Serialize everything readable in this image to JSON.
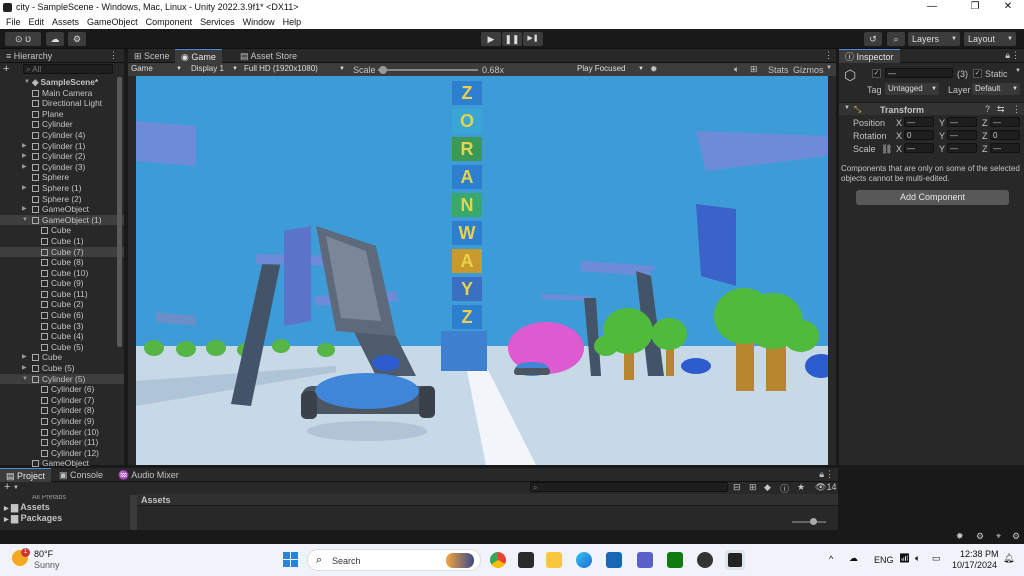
{
  "window": {
    "title": "city - SampleScene - Windows, Mac, Linux - Unity 2022.3.9f1* <DX11>",
    "minimize": "—",
    "maximize": "❐",
    "close": "✕"
  },
  "menu": [
    "File",
    "Edit",
    "Assets",
    "GameObject",
    "Component",
    "Services",
    "Window",
    "Help"
  ],
  "toolbar": {
    "account": "⊙ ט",
    "cloud": "☁",
    "play": "▶",
    "pause": "❚❚",
    "step": "▶❚",
    "layers": "Layers",
    "layout": "Layout",
    "history": "↺",
    "search": "⌕"
  },
  "hierarchy": {
    "tab": "Hierarchy",
    "add": "+",
    "search_placeholder": "All",
    "scene": "SampleScene*",
    "items": [
      {
        "label": "Main Camera",
        "indent": 2,
        "arrow": ""
      },
      {
        "label": "Directional Light",
        "indent": 2,
        "arrow": ""
      },
      {
        "label": "Plane",
        "indent": 2,
        "arrow": ""
      },
      {
        "label": "Cylinder",
        "indent": 2,
        "arrow": ""
      },
      {
        "label": "Cylinder (4)",
        "indent": 2,
        "arrow": ""
      },
      {
        "label": "Cylinder (1)",
        "indent": 2,
        "arrow": "▶"
      },
      {
        "label": "Cylinder (2)",
        "indent": 2,
        "arrow": "▶"
      },
      {
        "label": "Cylinder (3)",
        "indent": 2,
        "arrow": "▶"
      },
      {
        "label": "Sphere",
        "indent": 2,
        "arrow": ""
      },
      {
        "label": "Sphere (1)",
        "indent": 2,
        "arrow": "▶"
      },
      {
        "label": "Sphere (2)",
        "indent": 2,
        "arrow": ""
      },
      {
        "label": "GameObject",
        "indent": 2,
        "arrow": "▶"
      },
      {
        "label": "GameObject (1)",
        "indent": 2,
        "arrow": "▼",
        "sel": true
      },
      {
        "label": "Cube",
        "indent": 3,
        "arrow": ""
      },
      {
        "label": "Cube (1)",
        "indent": 3,
        "arrow": ""
      },
      {
        "label": "Cube (7)",
        "indent": 3,
        "arrow": "",
        "sel": true
      },
      {
        "label": "Cube (8)",
        "indent": 3,
        "arrow": ""
      },
      {
        "label": "Cube (10)",
        "indent": 3,
        "arrow": ""
      },
      {
        "label": "Cube (9)",
        "indent": 3,
        "arrow": ""
      },
      {
        "label": "Cube (11)",
        "indent": 3,
        "arrow": ""
      },
      {
        "label": "Cube (2)",
        "indent": 3,
        "arrow": ""
      },
      {
        "label": "Cube (6)",
        "indent": 3,
        "arrow": ""
      },
      {
        "label": "Cube (3)",
        "indent": 3,
        "arrow": ""
      },
      {
        "label": "Cube (4)",
        "indent": 3,
        "arrow": ""
      },
      {
        "label": "Cube (5)",
        "indent": 3,
        "arrow": ""
      },
      {
        "label": "Cube",
        "indent": 2,
        "arrow": "▶"
      },
      {
        "label": "Cube (5)",
        "indent": 2,
        "arrow": "▶"
      },
      {
        "label": "Cylinder (5)",
        "indent": 2,
        "arrow": "▼",
        "sel": true
      },
      {
        "label": "Cylinder (6)",
        "indent": 3,
        "arrow": ""
      },
      {
        "label": "Cylinder (7)",
        "indent": 3,
        "arrow": ""
      },
      {
        "label": "Cylinder (8)",
        "indent": 3,
        "arrow": ""
      },
      {
        "label": "Cylinder (9)",
        "indent": 3,
        "arrow": ""
      },
      {
        "label": "Cylinder (10)",
        "indent": 3,
        "arrow": ""
      },
      {
        "label": "Cylinder (11)",
        "indent": 3,
        "arrow": ""
      },
      {
        "label": "Cylinder (12)",
        "indent": 3,
        "arrow": ""
      },
      {
        "label": "GameObject",
        "indent": 2,
        "arrow": ""
      }
    ]
  },
  "game": {
    "tabs": [
      "Scene",
      "Game",
      "Asset Store"
    ],
    "display_mode": "Game",
    "display": "Display 1",
    "resolution": "Full HD (1920x1080)",
    "scale_label": "Scale",
    "scale_value": "0.68x",
    "scale_fraction": 0.05,
    "play_focused": "Play Focused",
    "stats": "Stats",
    "gizmos": "Gizmos",
    "tower_letters": [
      "Z",
      "Y",
      "A",
      "W",
      "N",
      "A",
      "R",
      "O",
      "Z"
    ]
  },
  "inspector": {
    "tab": "Inspector",
    "name_value": "—",
    "count": "(3)",
    "static_label": "Static",
    "tag_label": "Tag",
    "tag_value": "Untagged",
    "layer_label": "Layer",
    "layer_value": "Default",
    "transform_title": "Transform",
    "rows": [
      {
        "label": "Position",
        "x": "—",
        "y": "—",
        "z": "—"
      },
      {
        "label": "Rotation",
        "x": "0",
        "y": "—",
        "z": "0"
      },
      {
        "label": "Scale",
        "x": "—",
        "y": "—",
        "z": "—"
      }
    ],
    "axis_x": "X",
    "axis_y": "Y",
    "axis_z": "Z",
    "note": "Components that are only on some of the selected objects cannot be multi-edited.",
    "add_component": "Add Component"
  },
  "bottom": {
    "tabs": [
      "Project",
      "Console",
      "Audio Mixer"
    ],
    "add": "+",
    "favorites": "All Prefabs",
    "assets_tree": "Assets",
    "packages": "Packages",
    "assets_header": "Assets",
    "hidden_count": "14"
  },
  "taskbar": {
    "weather_temp": "80°F",
    "weather_desc": "Sunny",
    "search_placeholder": "Search",
    "lang": "ENG",
    "time": "12:38 PM",
    "date": "10/17/2024",
    "badge": "1"
  },
  "colors": {
    "sky": "#3a9bd9",
    "ground": "#bcd2e3",
    "accent": "#4a8fd6"
  }
}
